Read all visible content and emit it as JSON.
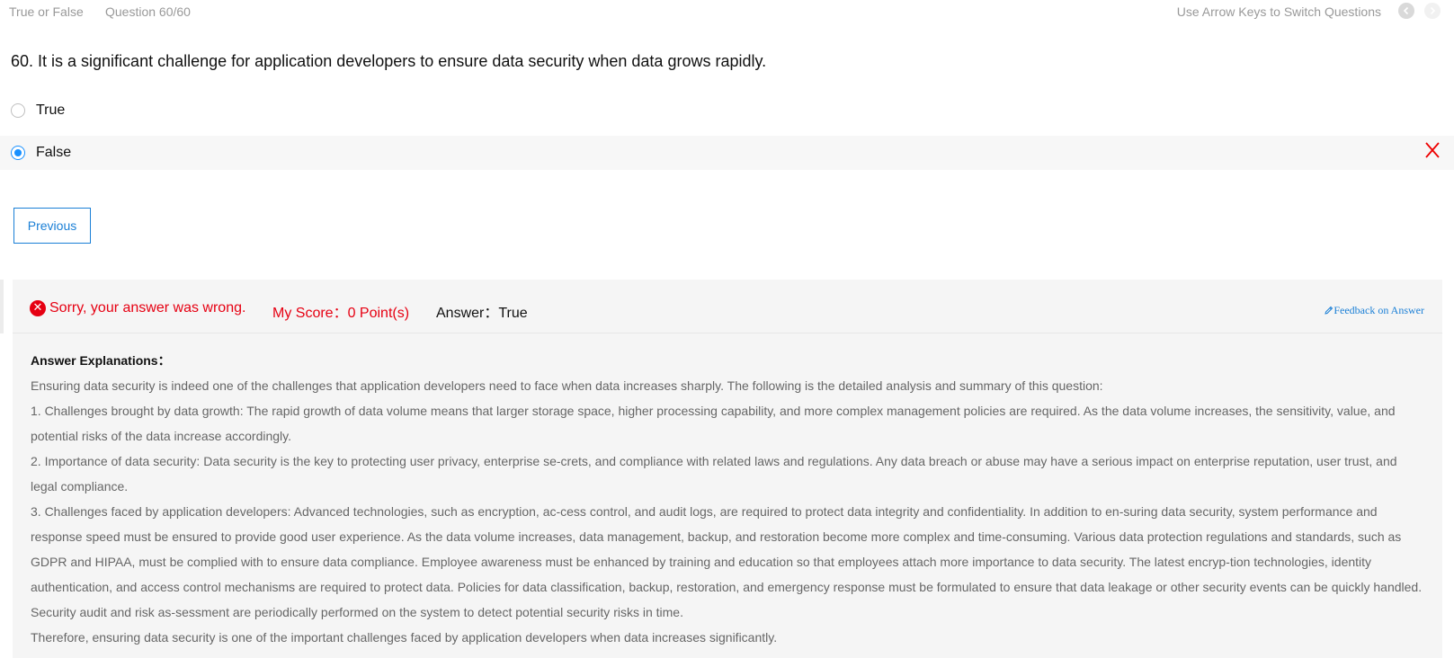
{
  "header": {
    "question_type": "True or False",
    "question_count": "Question 60/60",
    "hint": "Use Arrow Keys to Switch Questions",
    "prev_icon": "chevron-left-icon",
    "next_icon": "chevron-right-icon"
  },
  "question": {
    "text": "60. It is a significant challenge for application developers to ensure data security when data grows rapidly."
  },
  "options": [
    {
      "label": "True",
      "selected": false
    },
    {
      "label": "False",
      "selected": true,
      "marked_wrong": true
    }
  ],
  "buttons": {
    "previous": "Previous"
  },
  "result": {
    "status_text": "Sorry, your answer was wrong.",
    "score_text": "My Score：0 Point(s)",
    "answer_text": "Answer：True",
    "feedback_link": "Feedback on Answer"
  },
  "explanation": {
    "title": "Answer Explanations：",
    "paragraphs": [
      "Ensuring data security is indeed one of the challenges that application developers need to face when data increases sharply. The following is the detailed analysis and summary of this question:",
      "1. Challenges brought by data growth: The rapid growth of data volume means that larger storage space, higher processing capability, and more complex management policies are required. As the data volume increases, the sensitivity, value, and potential risks of the data increase accordingly.",
      "2. Importance of data security: Data security is the key to protecting user privacy, enterprise se-crets, and compliance with related laws and regulations. Any data breach or abuse may have a serious impact on enterprise reputation, user trust, and legal compliance.",
      "3. Challenges faced by application developers: Advanced technologies, such as encryption, ac-cess control, and audit logs, are required to protect data integrity and confidentiality. In addition to en-suring data security, system performance and response speed must be ensured to provide good user experience. As the data volume increases, data management, backup, and restoration become more complex and time-consuming. Various data protection regulations and standards, such as GDPR and HIPAA, must be complied with to ensure data compliance. Employee awareness must be enhanced by training and education so that employees attach more importance to data security. The latest encryp-tion technologies, identity authentication, and access control mechanisms are required to protect data. Policies for data classification, backup, restoration, and emergency response must be formulated to ensure that data leakage or other security events can be quickly handled. Security audit and risk as-sessment are periodically performed on the system to detect potential security risks in time.",
      "Therefore, ensuring data security is one of the important challenges faced by application developers when data increases significantly."
    ]
  },
  "colors": {
    "accent": "#1890ff",
    "error": "#e60012",
    "link": "#1a7fd6"
  }
}
